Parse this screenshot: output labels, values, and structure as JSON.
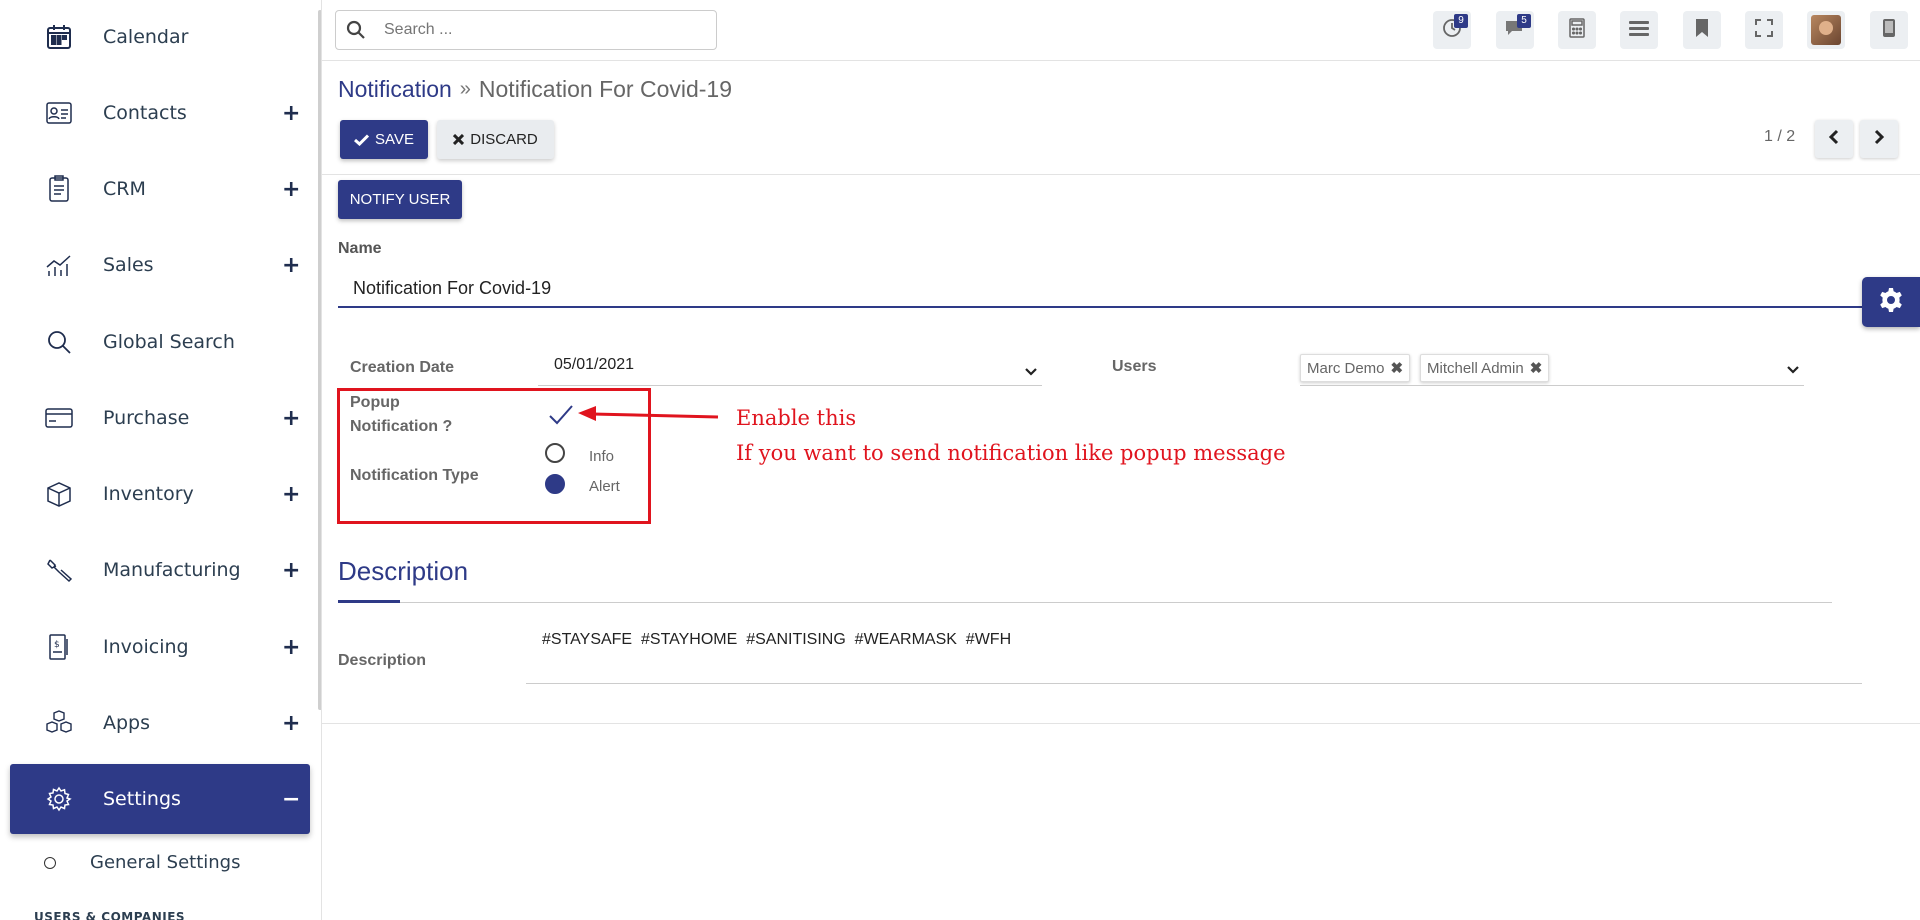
{
  "sidebar": {
    "items": [
      {
        "label": "Calendar",
        "icon": "calendar-icon",
        "expand": ""
      },
      {
        "label": "Contacts",
        "icon": "contact-card-icon",
        "expand": "+"
      },
      {
        "label": "CRM",
        "icon": "crm-clipboard-icon",
        "expand": "+"
      },
      {
        "label": "Sales",
        "icon": "sales-chart-icon",
        "expand": "+"
      },
      {
        "label": "Global Search",
        "icon": "search-icon",
        "expand": ""
      },
      {
        "label": "Purchase",
        "icon": "credit-card-icon",
        "expand": "+"
      },
      {
        "label": "Inventory",
        "icon": "box-icon",
        "expand": "+"
      },
      {
        "label": "Manufacturing",
        "icon": "wrench-icon",
        "expand": "+"
      },
      {
        "label": "Invoicing",
        "icon": "invoice-icon",
        "expand": "+"
      },
      {
        "label": "Apps",
        "icon": "apps-cubes-icon",
        "expand": "+"
      },
      {
        "label": "Settings",
        "icon": "gear-icon",
        "expand": "−"
      }
    ],
    "sub_item": "General Settings",
    "cut_off_heading": "USERS & COMPANIES"
  },
  "topbar": {
    "search_placeholder": "Search ...",
    "activity_badge": "9",
    "messages_badge": "5"
  },
  "breadcrumb": {
    "parent": "Notification",
    "separator": "»",
    "current": "Notification For Covid-19"
  },
  "toolbar": {
    "save_label": "SAVE",
    "discard_label": "DISCARD",
    "notify_label": "NOTIFY USER",
    "pager": "1 / 2"
  },
  "form": {
    "name_label": "Name",
    "name_value": "Notification For Covid-19",
    "creation_date_label": "Creation Date",
    "creation_date_value": "05/01/2021",
    "users_label": "Users",
    "users": [
      "Marc Demo",
      "Mitchell Admin"
    ],
    "popup_label_line1": "Popup",
    "popup_label_line2": "Notification ?",
    "popup_checked": true,
    "notification_type_label": "Notification Type",
    "notification_type_options": [
      "Info",
      "Alert"
    ],
    "notification_type_selected": "Alert",
    "description_tab": "Description",
    "description_label": "Description",
    "description_value": "#STAYSAFE  #STAYHOME  #SANITISING  #WEARMASK  #WFH"
  },
  "annotation": {
    "line1": "Enable this",
    "line2": "If you want to send notification like popup message",
    "color": "#e0141e"
  },
  "colors": {
    "brand": "#2e3a87"
  }
}
